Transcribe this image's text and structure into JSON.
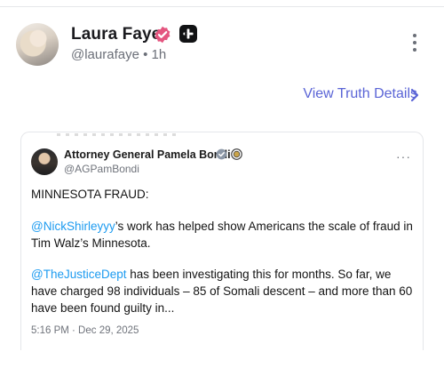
{
  "post": {
    "author_name": "Laura Faye",
    "handle": "@laurafaye",
    "separator": "•",
    "time_ago": "1h",
    "view_details_label": "View Truth Details",
    "icons": {
      "avatar": "profile-photo",
      "verified": "verified-badge-icon",
      "plus": "plus-badge-icon",
      "menu": "vertical-dots-icon",
      "chevron": "chevron-right-icon"
    },
    "colors": {
      "verified_badge": "#e4557f",
      "link_accent": "#5a64d6"
    }
  },
  "quote": {
    "author_name": "Attorney General Pamela Bondi",
    "handle": "@AGPamBondi",
    "more": "···",
    "heading": "MINNESOTA FRAUD:",
    "para1_mention": "@NickShirleyyy",
    "para1_text": "’s work has helped show Americans the scale of fraud in Tim Walz’s Minnesota.",
    "para2_mention": "@TheJusticeDept",
    "para2_text": " has been investigating this for months. So far, we have charged 98 individuals – 85 of Somali descent – and more than 60 have been found guilty in...",
    "timestamp": "5:16 PM · Dec 29, 2025",
    "colors": {
      "mention": "#1d9bf0",
      "verified_badge": "#8c97a6"
    }
  }
}
